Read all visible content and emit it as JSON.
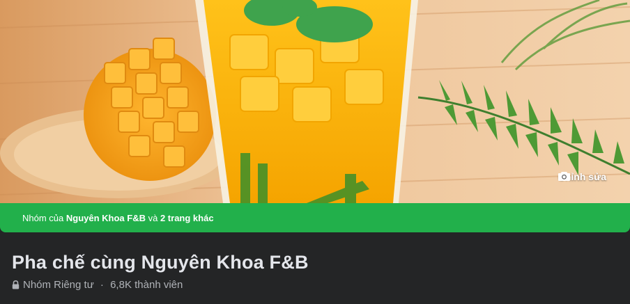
{
  "cover": {
    "edit_label": "Chỉnh sửa",
    "icons": {
      "edit": "camera-icon"
    }
  },
  "banner": {
    "prefix": "Nhóm của ",
    "owner": "Nguyên Khoa F&B",
    "joiner": " và ",
    "others": "2 trang khác",
    "color": "#22b04b"
  },
  "group": {
    "title": "Pha chế cùng Nguyên Khoa F&B",
    "privacy": "Nhóm Riêng tư",
    "separator": " · ",
    "members": "6,8K thành viên",
    "icons": {
      "privacy": "lock-icon"
    }
  },
  "colors": {
    "page_bg": "#242526",
    "title_text": "#e4e6eb",
    "meta_text": "#b0b3b8"
  }
}
